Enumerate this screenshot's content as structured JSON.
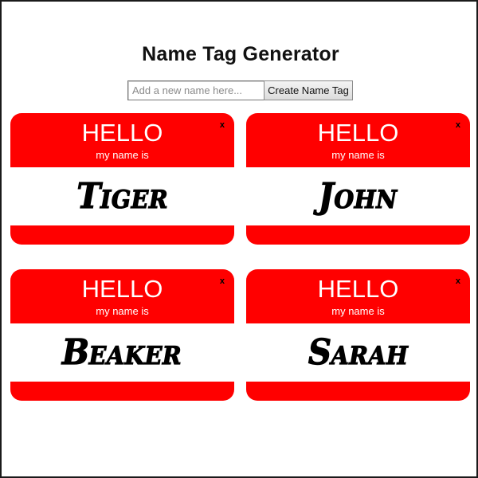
{
  "header": {
    "title": "Name Tag Generator"
  },
  "form": {
    "input_value": "",
    "input_placeholder": "Add a new name here...",
    "button_label": "Create Name Tag"
  },
  "tag_text": {
    "hello": "HELLO",
    "subtitle": "my name is",
    "close": "x"
  },
  "tags": [
    {
      "name": "Tiger"
    },
    {
      "name": "John"
    },
    {
      "name": "Beaker"
    },
    {
      "name": "Sarah"
    }
  ],
  "colors": {
    "tag_red": "#ff0000",
    "tag_text": "#ffffff",
    "page_bg": "#ffffff"
  }
}
